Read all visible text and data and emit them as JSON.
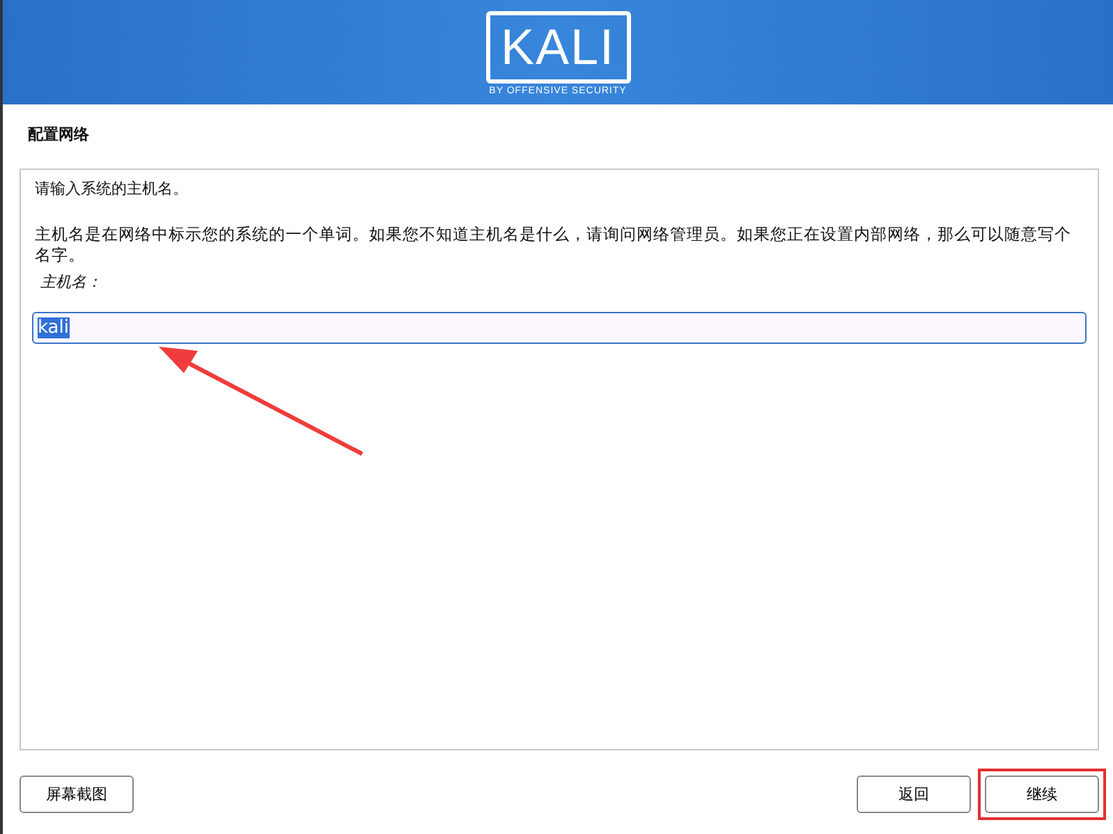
{
  "header": {
    "logo_text": "KALI",
    "logo_tagline": "BY OFFENSIVE SECURITY"
  },
  "title": "配置网络",
  "prompt": "请输入系统的主机名。",
  "description": "主机名是在网络中标示您的系统的一个单词。如果您不知道主机名是什么，请询问网络管理员。如果您正在设置内部网络，那么可以随意写个名字。",
  "field": {
    "label": "主机名：",
    "value": "kali",
    "text_selected": true
  },
  "annotation": {
    "kind": "arrow"
  },
  "left_buttons": [
    {
      "label": "屏幕截图",
      "highlighted": false
    }
  ],
  "right_buttons": [
    {
      "label": "返回",
      "highlighted": false
    },
    {
      "label": "继续",
      "highlighted": true
    }
  ]
}
